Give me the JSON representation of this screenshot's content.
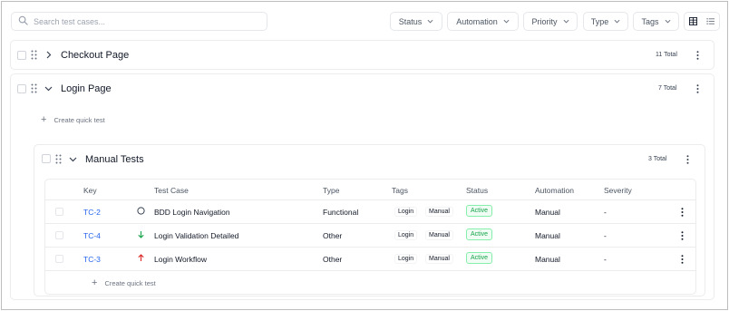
{
  "search": {
    "placeholder": "Search test cases..."
  },
  "filters": [
    {
      "label": "Status"
    },
    {
      "label": "Automation"
    },
    {
      "label": "Priority"
    },
    {
      "label": "Type"
    },
    {
      "label": "Tags"
    }
  ],
  "groups": [
    {
      "title": "Checkout Page",
      "count": "11 Total",
      "expanded": false
    },
    {
      "title": "Login Page",
      "count": "7 Total",
      "expanded": true,
      "quick_label": "Create quick test"
    }
  ],
  "subgroup": {
    "title": "Manual Tests",
    "count": "3 Total",
    "quick_label": "Create quick test"
  },
  "table": {
    "columns": [
      "Key",
      "Test Case",
      "Type",
      "Tags",
      "Status",
      "Automation",
      "Severity"
    ],
    "rows": [
      {
        "key": "TC-2",
        "priority_icon": "circle-icon",
        "name": "BDD Login Navigation",
        "type": "Functional",
        "tags": [
          "Login",
          "Manual"
        ],
        "status": "Active",
        "automation": "Manual",
        "severity": "-"
      },
      {
        "key": "TC-4",
        "priority_icon": "arrow-down-icon",
        "name": "Login Validation Detailed",
        "type": "Other",
        "tags": [
          "Login",
          "Manual"
        ],
        "status": "Active",
        "automation": "Manual",
        "severity": "-"
      },
      {
        "key": "TC-3",
        "priority_icon": "arrow-up-icon",
        "name": "Login Workflow",
        "type": "Other",
        "tags": [
          "Login",
          "Manual"
        ],
        "status": "Active",
        "automation": "Manual",
        "severity": "-"
      }
    ]
  },
  "colors": {
    "link": "#2563eb",
    "active_text": "#16a34a",
    "active_bg": "#f0fdf4",
    "arrow_down": "#16a34a",
    "arrow_up": "#dc2626"
  }
}
